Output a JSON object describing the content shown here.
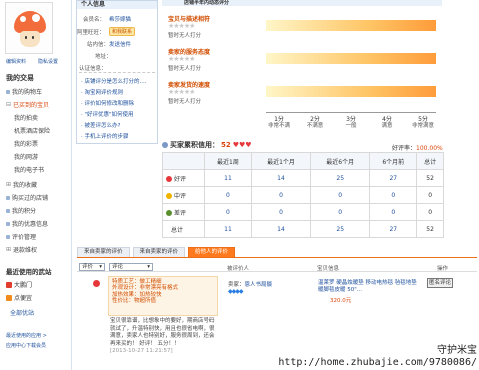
{
  "sidebar": {
    "edit_profile": "编辑资料",
    "account_settings": "隐私设置",
    "my_trades_heading": "我的交易",
    "items": [
      {
        "label": "我的购物车"
      },
      {
        "label": "已买到的宝贝",
        "active": true
      },
      {
        "label": "我的拍卖"
      },
      {
        "label": "机票酒店保险"
      },
      {
        "label": "我的彩票"
      },
      {
        "label": "我的网游"
      },
      {
        "label": "我的电子书"
      },
      {
        "label": "我的收藏"
      },
      {
        "label": "购买过的店铺"
      },
      {
        "label": "我的积分"
      },
      {
        "label": "我的优惠信息"
      },
      {
        "label": "评价管理"
      },
      {
        "label": "退款维权"
      }
    ],
    "recent_title": "最近使用的武站",
    "recent": [
      {
        "label": "大鹏门"
      },
      {
        "label": "点便宜"
      },
      {
        "label": "全部优站"
      }
    ],
    "footer_links": [
      "最近使用的应用 >",
      "应用中心下载会员"
    ]
  },
  "profile": {
    "header": "个人信息",
    "member_label": "会员名：",
    "member_value": "希莎嫁猫",
    "wangwang_label": "阿里旺旺：",
    "wangwang_value": "和我联系",
    "station_label": "站内信：",
    "station_value": "发送信件",
    "address_label": "地址：",
    "cert_label": "认证信息：",
    "links": [
      "店铺评分是怎么打分的....",
      "淘宝网评价规则",
      "评价如何修改和删除",
      "\"好评优惠\"如何使用",
      "被差评怎么办?",
      "手机上评价的步骤"
    ]
  },
  "rating": {
    "header": "店铺半年内动态评分",
    "items": [
      {
        "label": "宝贝与描述相符",
        "note": "暂时无人打分"
      },
      {
        "label": "卖家的服务态度",
        "note": "暂时无人打分"
      },
      {
        "label": "卖家发货的速度",
        "note": "暂时无人打分"
      }
    ],
    "scale": [
      {
        "num": "1分",
        "txt": "非常不满"
      },
      {
        "num": "2分",
        "txt": "不满意"
      },
      {
        "num": "3分",
        "txt": "一般"
      },
      {
        "num": "4分",
        "txt": "满意"
      },
      {
        "num": "5分",
        "txt": "非常满意"
      }
    ]
  },
  "credit": {
    "title": "买家累积信用：",
    "value": "52",
    "good_rate_label": "好评率：",
    "good_rate_value": "100.00%",
    "columns": [
      "",
      "最近1周",
      "最近1个月",
      "最近6个月",
      "6个月前",
      "总计"
    ],
    "rows": [
      {
        "label": "好评",
        "color": "#e6383b",
        "values": [
          "11",
          "14",
          "25",
          "27",
          "52"
        ]
      },
      {
        "label": "中评",
        "color": "#f0b400",
        "values": [
          "0",
          "0",
          "0",
          "0",
          "0"
        ]
      },
      {
        "label": "差评",
        "color": "#5a8f2e",
        "values": [
          "0",
          "0",
          "0",
          "0",
          "0"
        ]
      },
      {
        "label": "总计",
        "color": "",
        "values": [
          "11",
          "14",
          "25",
          "27",
          "52"
        ]
      }
    ]
  },
  "tabs": [
    {
      "label": "来自卖家的评价"
    },
    {
      "label": "来自卖家的评价"
    },
    {
      "label": "给他人的评价",
      "active": true
    }
  ],
  "review_list": {
    "filter1": "评价",
    "filter2": "评论",
    "col_person": "被评价人",
    "col_item": "宝贝信息",
    "col_op": "操作"
  },
  "review": {
    "lines": [
      "特质工艺：做工精细",
      "外观设计：非常漂亮有格式",
      "加热效果：加热较快",
      "性价比：物超所值"
    ],
    "body": "宝贝很靠谱，比想象中的要好，期商店号码就试了，升温特别快，用且也很省电啊，很满意，卖家人也特别好，服务很周到，还会再来买的！ 好评！ 五分！！",
    "time": "[2013-10-27 11:21:57]",
    "seller_label": "卖家：",
    "seller_name": "恩人书局摄",
    "diamonds": "💎💎💎💎",
    "item_title": "温莱罗 硬晶烛暖垫 移动电热毯 毡毯地垫 暖脚毯皮暖 50\"...",
    "price": "320.0元",
    "op_button": "匿名评论"
  },
  "watermark": [
    "守护米宝",
    "http://home.zhubajie.com/9780086/"
  ]
}
